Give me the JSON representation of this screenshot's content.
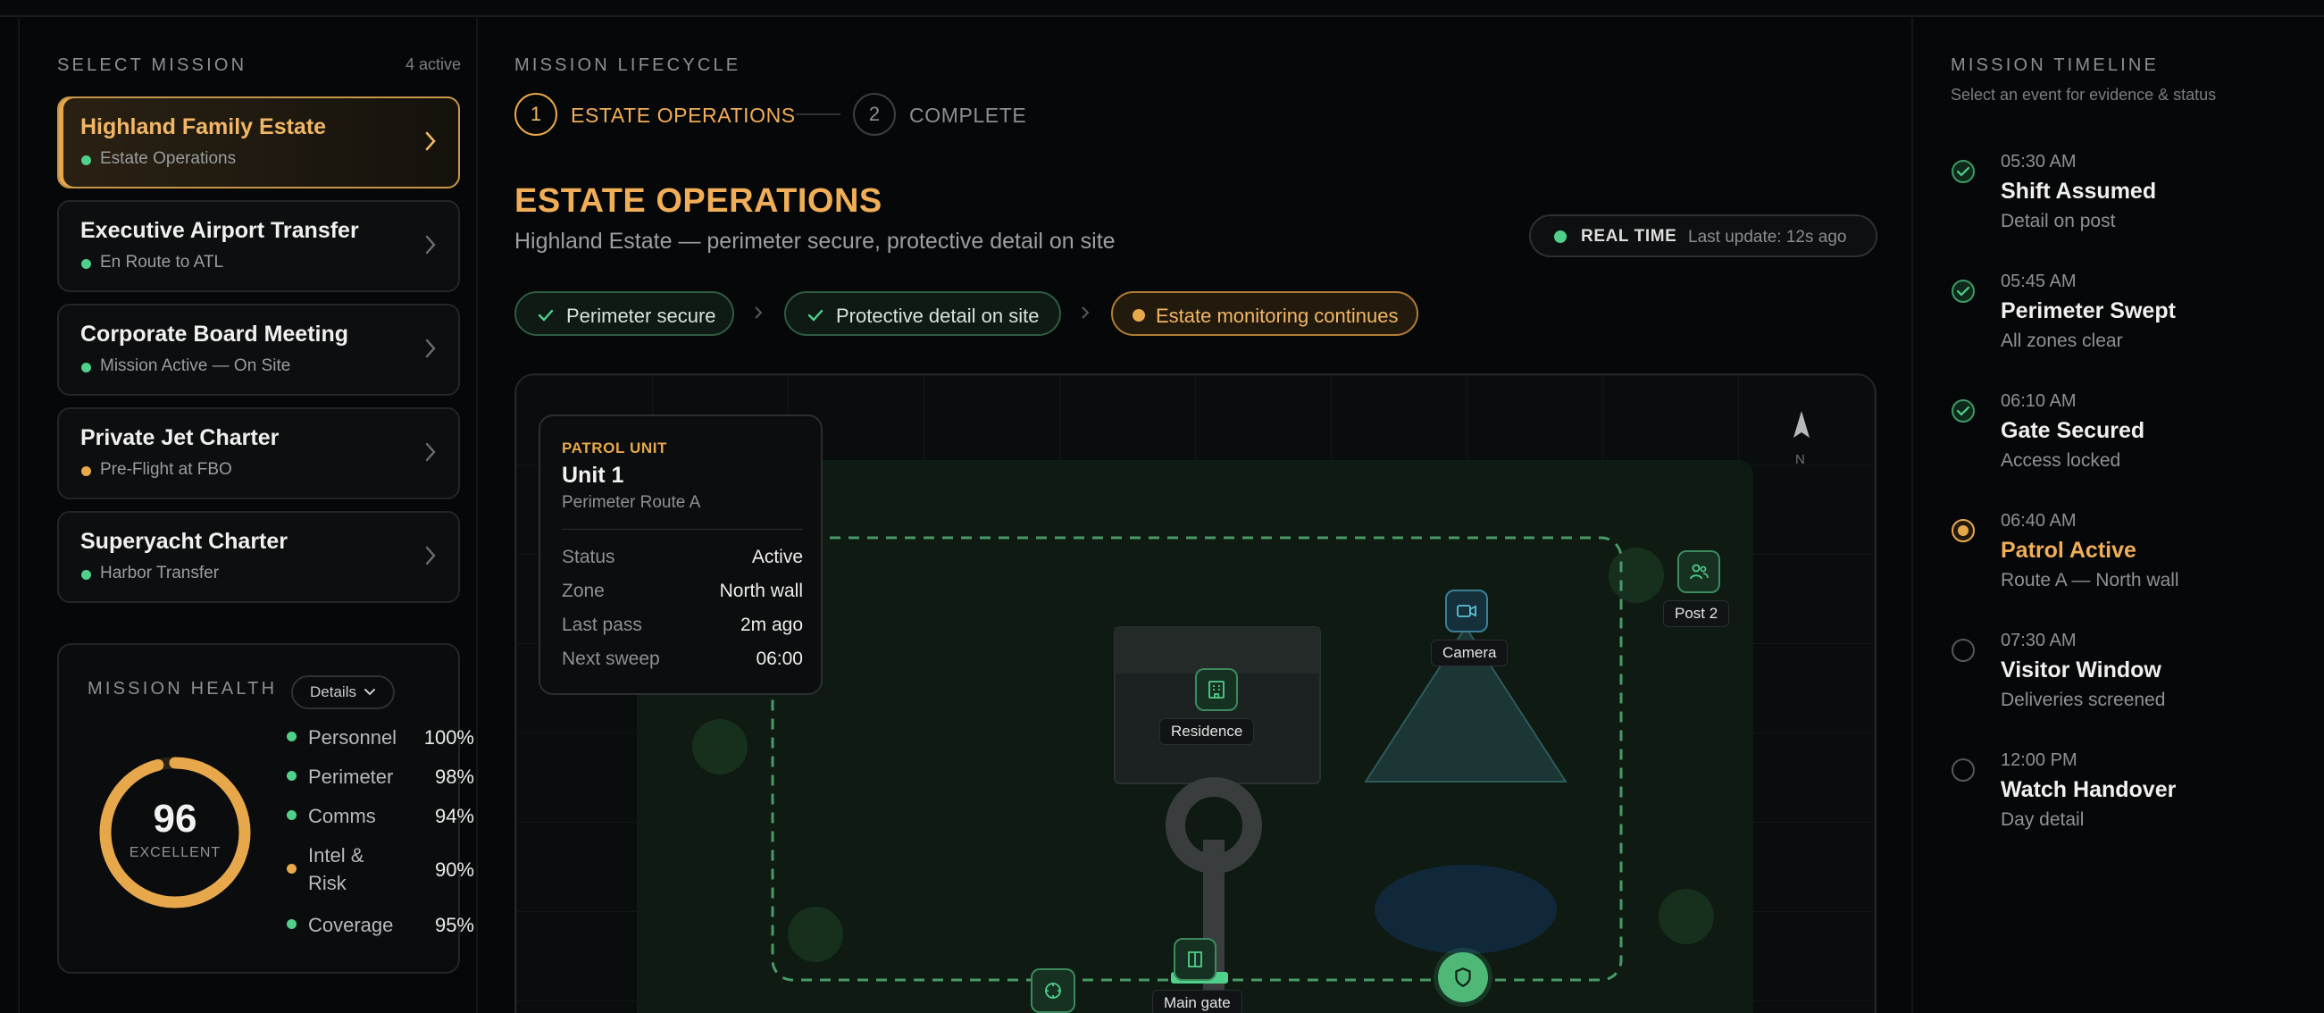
{
  "left": {
    "select_label": "SELECT MISSION",
    "active_count": "4 active",
    "missions": [
      {
        "title": "Highland Family Estate",
        "status": "Estate Operations",
        "status_color": "#4fd18b",
        "selected": true
      },
      {
        "title": "Executive Airport Transfer",
        "status": "En Route to ATL",
        "status_color": "#4fd18b"
      },
      {
        "title": "Corporate Board Meeting",
        "status": "Mission Active — On Site",
        "status_color": "#4fd18b"
      },
      {
        "title": "Private Jet Charter",
        "status": "Pre-Flight at FBO",
        "status_color": "#e8a94b"
      },
      {
        "title": "Superyacht Charter",
        "status": "Harbor Transfer",
        "status_color": "#4fd18b"
      }
    ],
    "health": {
      "label": "MISSION HEALTH",
      "details": "Details",
      "score": "96",
      "score_label": "EXCELLENT",
      "score_fraction": 0.96,
      "metrics": [
        {
          "name": "Personnel",
          "value": "100%",
          "color": "#4fd18b"
        },
        {
          "name": "Perimeter",
          "value": "98%",
          "color": "#4fd18b"
        },
        {
          "name": "Comms",
          "value": "94%",
          "color": "#4fd18b"
        },
        {
          "name": "Intel & Risk",
          "value": "90%",
          "color": "#e8a94b"
        },
        {
          "name": "Coverage",
          "value": "95%",
          "color": "#4fd18b"
        }
      ]
    }
  },
  "center": {
    "lifecycle_label": "MISSION LIFECYCLE",
    "steps": [
      {
        "num": "1",
        "label": "ESTATE OPERATIONS",
        "active": true
      },
      {
        "num": "2",
        "label": "COMPLETE",
        "active": false
      }
    ],
    "heading": "ESTATE OPERATIONS",
    "subheading": "Highland Estate — perimeter secure, protective detail on site",
    "realtime": {
      "label": "REAL TIME",
      "updated": "Last update: 12s ago"
    },
    "chips": [
      {
        "label": "Perimeter secure",
        "state": "done"
      },
      {
        "label": "Protective detail on site",
        "state": "done"
      },
      {
        "label": "Estate monitoring continues",
        "state": "current"
      }
    ],
    "map": {
      "compass": "N",
      "labels": {
        "residence": "Residence",
        "camera": "Camera",
        "post2": "Post 2",
        "main_gate": "Main gate"
      },
      "unit_card": {
        "tag": "PATROL UNIT",
        "title": "Unit 1",
        "subtitle": "Perimeter Route A",
        "rows": [
          {
            "k": "Status",
            "v": "Active"
          },
          {
            "k": "Zone",
            "v": "North wall"
          },
          {
            "k": "Last pass",
            "v": "2m ago"
          },
          {
            "k": "Next sweep",
            "v": "06:00"
          }
        ]
      }
    }
  },
  "right": {
    "title": "MISSION TIMELINE",
    "subtitle": "Select an event for evidence & status",
    "events": [
      {
        "time": "05:30 AM",
        "title": "Shift Assumed",
        "desc": "Detail on post",
        "state": "done"
      },
      {
        "time": "05:45 AM",
        "title": "Perimeter Swept",
        "desc": "All zones clear",
        "state": "done"
      },
      {
        "time": "06:10 AM",
        "title": "Gate Secured",
        "desc": "Access locked",
        "state": "done"
      },
      {
        "time": "06:40 AM",
        "title": "Patrol Active",
        "desc": "Route A — North wall",
        "state": "current"
      },
      {
        "time": "07:30 AM",
        "title": "Visitor Window",
        "desc": "Deliveries screened",
        "state": "pending"
      },
      {
        "time": "12:00 PM",
        "title": "Watch Handover",
        "desc": "Day detail",
        "state": "pending"
      }
    ]
  }
}
